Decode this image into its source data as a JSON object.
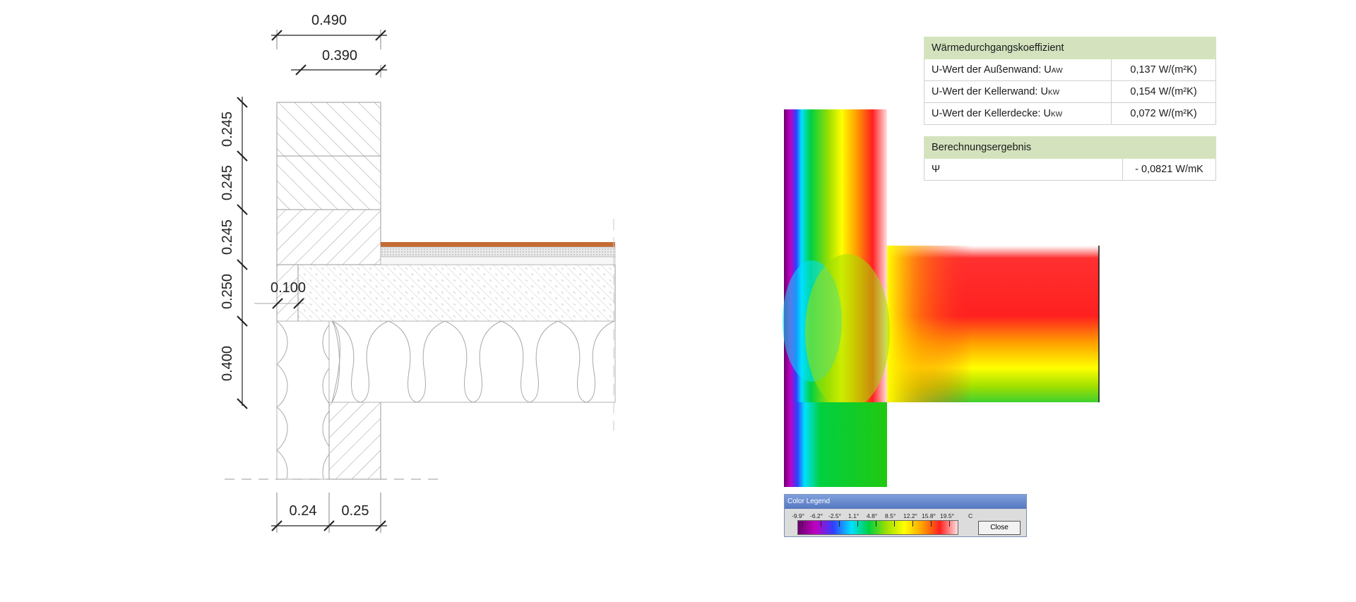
{
  "dimensions": {
    "top": [
      "0.490",
      "0.390"
    ],
    "left": [
      "0.245",
      "0.245",
      "0.245",
      "0.250",
      "0.400"
    ],
    "inner": "0.100",
    "bottom": [
      "0.24",
      "0.25"
    ]
  },
  "u_values": {
    "header": "Wärmedurchgangskoeffizient",
    "rows": [
      {
        "label": "U-Wert der Außenwand: U",
        "sub": "AW",
        "value": "0,137 W/(m²K)"
      },
      {
        "label": "U-Wert der Kellerwand:  U",
        "sub": "KW",
        "value": "0,154 W/(m²K)"
      },
      {
        "label": "U-Wert der Kellerdecke: U",
        "sub": "KW",
        "value": "0,072 W/(m²K)"
      }
    ]
  },
  "result": {
    "header": "Berechnungsergebnis",
    "label": "Ψ",
    "value": "- 0,0821 W/mK"
  },
  "color_legend": {
    "title": "Color Legend",
    "ticks": [
      "-9.9°",
      "-6.2°",
      "-2.5°",
      "1.1°",
      "4.8°",
      "8.5°",
      "12.2°",
      "15.8°",
      "19.5°"
    ],
    "unit": "C",
    "close_label": "Close",
    "colors": [
      "#6a0070",
      "#c000c0",
      "#3040ff",
      "#00e0ff",
      "#00d040",
      "#a0e000",
      "#ffff00",
      "#ffa000",
      "#ff2020",
      "#ffe0e0"
    ]
  }
}
